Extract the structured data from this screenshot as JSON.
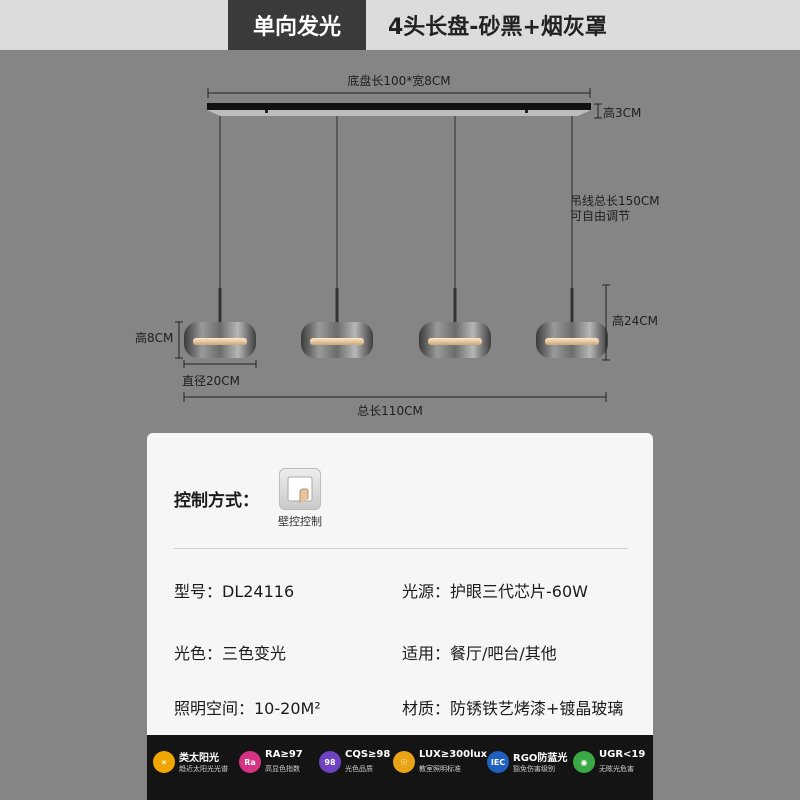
{
  "header": {
    "tag": "单向发光",
    "title": "4头长盘-砂黑+烟灰罩"
  },
  "dimensions": {
    "base": "底盘长100*宽8CM",
    "base_height": "高3CM",
    "cable_line1": "吊线总长150CM",
    "cable_line2": "可自由调节",
    "lamp_height": "高24CM",
    "shade_height": "高8CM",
    "diameter": "直径20CM",
    "total_length": "总长110CM"
  },
  "card": {
    "control_label": "控制方式：",
    "control_icon": "wall-switch-icon",
    "control_text": "壁控控制",
    "specs": {
      "model": "型号：DL24116",
      "light_source": "光源：护眼三代芯片-60W",
      "light_color": "光色：三色变光",
      "usage": "适用：餐厅/吧台/其他",
      "space": "照明空间：10-20M²",
      "material": "材质：防锈铁艺烤漆+镀晶玻璃"
    }
  },
  "badges": [
    {
      "icon": "sun-icon",
      "glyph": "☀",
      "title": "类太阳光",
      "sub": "趋近太阳光光谱",
      "color": "#f0a500"
    },
    {
      "icon": "ra-icon",
      "glyph": "Ra",
      "title": "RA≥97",
      "sub": "高显色指数",
      "color": "#d63384"
    },
    {
      "icon": "cqs-icon",
      "glyph": "98",
      "title": "CQS≥98",
      "sub": "光色品质",
      "color": "#6f42c1"
    },
    {
      "icon": "lux-icon",
      "glyph": "☉",
      "title": "LUX≥300lux",
      "sub": "教室照明标准",
      "color": "#e8a317"
    },
    {
      "icon": "iec-icon",
      "glyph": "IEC",
      "title": "RGO防蓝光",
      "sub": "豁免伤害级别",
      "color": "#1f5fbf"
    },
    {
      "icon": "eye-icon",
      "glyph": "◉",
      "title": "UGR<19",
      "sub": "无眩光危害",
      "color": "#3aa845"
    }
  ]
}
